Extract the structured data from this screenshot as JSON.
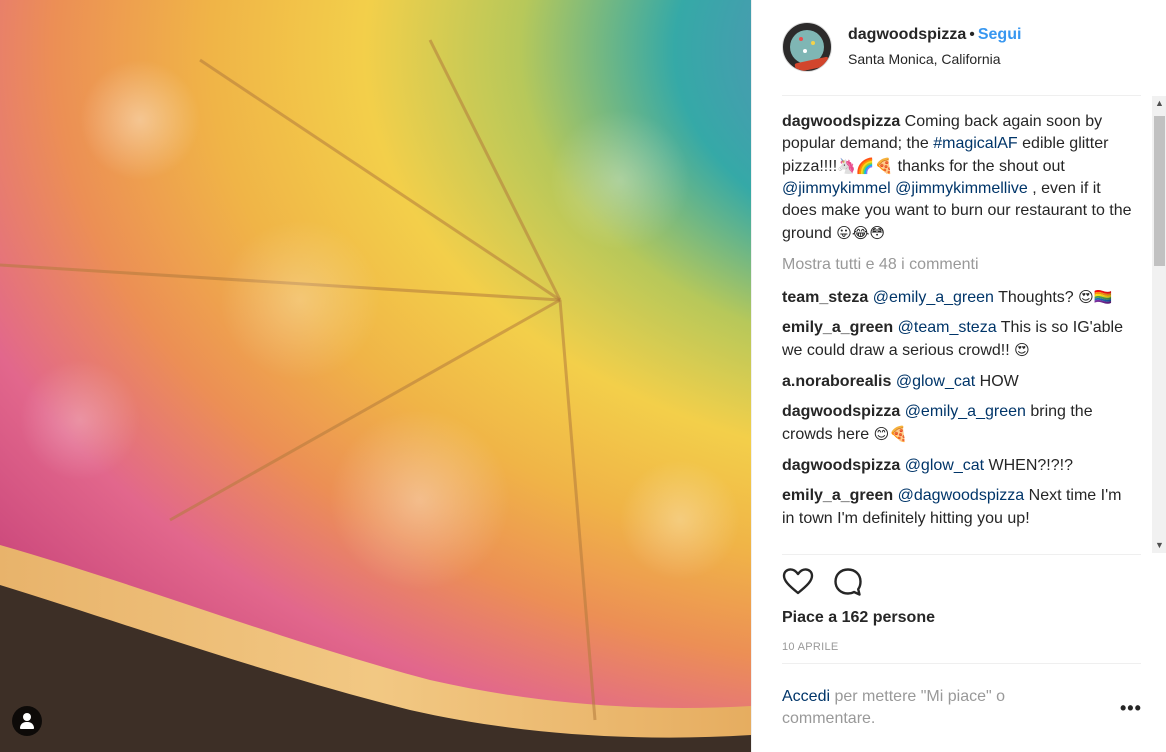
{
  "post": {
    "account": {
      "username": "dagwoodspizza",
      "separator": "•",
      "follow_label": "Segui",
      "location": "Santa Monica, California",
      "avatar_icon": "pizza-logo-icon"
    },
    "caption": {
      "user": "dagwoodspizza",
      "text_1": " Coming back again soon by popular demand; the ",
      "hashtag": "#magicalAF",
      "text_2": " edible glitter pizza!!!!",
      "emojis_1": "🦄🌈🍕",
      "text_3": " thanks for the shout out ",
      "mention_1": "@jimmykimmel",
      "text_4": " ",
      "mention_2": "@jimmykimmellive",
      "text_5": " , even if it does make you want to burn our restaurant to the ground ",
      "emojis_2": "😛😂😳"
    },
    "load_more_label": "Mostra tutti e 48 i commenti",
    "comments": [
      {
        "user": "team_steza",
        "mention": "@emily_a_green",
        "text": " Thoughts? ",
        "emoji": "😍🏳️‍🌈"
      },
      {
        "user": "emily_a_green",
        "mention": "@team_steza",
        "text": " This is so IG'able we could draw a serious crowd!! ",
        "emoji": "😍"
      },
      {
        "user": "a.noraborealis",
        "mention": "@glow_cat",
        "text": " HOW",
        "emoji": ""
      },
      {
        "user": "dagwoodspizza",
        "mention": "@emily_a_green",
        "text": " bring the crowds here ",
        "emoji": "😊🍕"
      },
      {
        "user": "dagwoodspizza",
        "mention": "@glow_cat",
        "text": " WHEN?!?!?",
        "emoji": ""
      },
      {
        "user": "emily_a_green",
        "mention": "@dagwoodspizza",
        "text": " Next time I'm in town I'm definitely hitting you up!",
        "emoji": ""
      }
    ],
    "likes_label": "Piace a 162 persone",
    "date_label": "10 APRILE",
    "login": {
      "link_label": "Accedi",
      "rest": " per mettere \"Mi piace\" o commentare."
    },
    "more_options_label": "•••",
    "actions": {
      "like_icon": "heart-icon",
      "comment_icon": "comment-bubble-icon"
    },
    "scrollbar": {
      "up_arrow": "▲",
      "down_arrow": "▼"
    },
    "photo": {
      "subject_icon": "rainbow-glitter-pizza-photo",
      "tag_icon": "user-tag-icon"
    }
  }
}
